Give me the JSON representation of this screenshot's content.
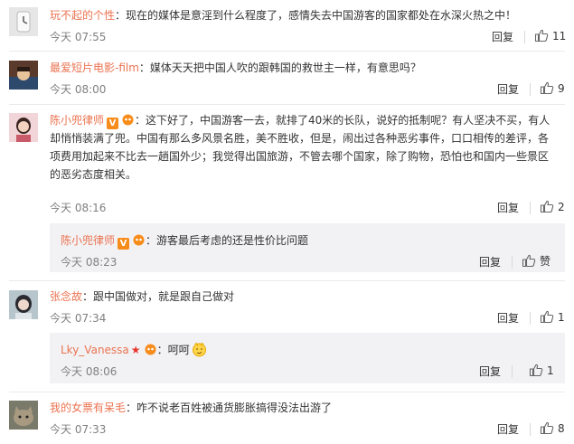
{
  "colors": {
    "username": "#eb7350",
    "time": "#808080",
    "text": "#333333",
    "separator": "#eaeaea",
    "reply_bg": "#f2f2f5"
  },
  "comments": [
    {
      "user": "玩不起的个性",
      "text": "：现在的媒体是意淫到什么程度了，感情失去中国游客的国家都处在水深火热之中！",
      "time": "今天 07:55",
      "reply": "回复",
      "likes": "11",
      "avatar_icon": "clock-avatar"
    },
    {
      "user": "最爱短片电影-film",
      "text": "：媒体天天把中国人吹的跟韩国的救世主一样，有意思吗？",
      "time": "今天 08:00",
      "reply": "回复",
      "likes": "9",
      "avatar_icon": "anime-avatar"
    },
    {
      "user": "陈小兜律师",
      "text": "：这下好了，中国游客一去，就排了40米的长队，说好的抵制呢？有人坚决不买，有人却悄悄装满了兜。中国有那么多风景名胜，美不胜收，但是，闹出过各种恶劣事件，口口相传的差评，各项费用加起来不比去一趟国外少；我觉得出国旅游，不管去哪个国家，除了购物，恐怕也和国内一些景区的恶劣态度相关。",
      "time": "今天 08:16",
      "reply": "回复",
      "likes": "2",
      "avatar_icon": "woman-avatar",
      "sub": {
        "user": "陈小兜律师",
        "text": "：游客最后考虑的还是性价比问题",
        "time": "今天 08:23",
        "reply": "回复",
        "likes": "赞"
      }
    },
    {
      "user": "张念故",
      "text": "：跟中国做对，就是跟自己做对",
      "time": "今天 07:34",
      "reply": "回复",
      "likes": "1",
      "avatar_icon": "girl-avatar",
      "sub": {
        "user": "Lky_Vanessa",
        "text": "：呵呵",
        "time": "今天 08:06",
        "reply": "回复",
        "likes": "1"
      }
    },
    {
      "user": "我的女票有呆毛",
      "text": "：咋不说老百姓被通货膨胀搞得没法出游了",
      "time": "今天 07:33",
      "reply": "回复",
      "likes": "8",
      "avatar_icon": "cat-avatar"
    }
  ]
}
